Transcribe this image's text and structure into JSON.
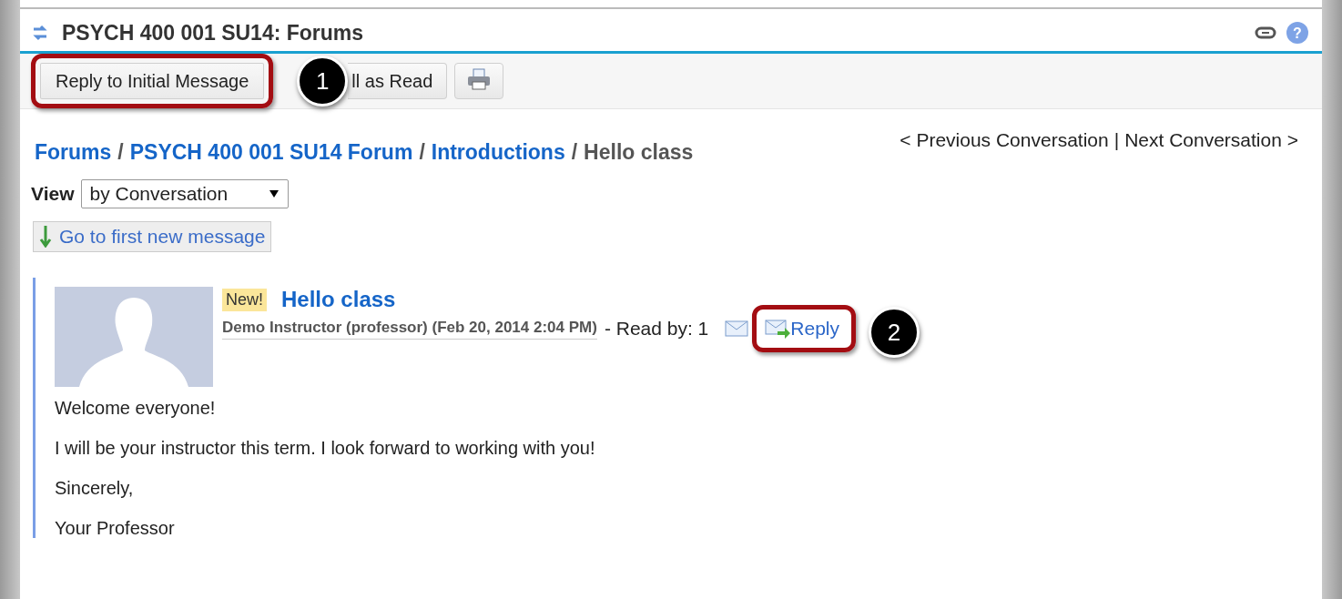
{
  "header": {
    "title": "PSYCH 400 001 SU14: Forums",
    "help": "?"
  },
  "toolbar": {
    "buttons": [
      {
        "label": "Reply to Initial Message",
        "highlighted": true
      },
      {
        "label": "ll as Read",
        "highlighted": false
      }
    ],
    "callout": "1"
  },
  "nav": {
    "previous": "< Previous Conversation",
    "separator": "|",
    "next": "Next Conversation >"
  },
  "breadcrumb": {
    "links": [
      "Forums",
      "PSYCH 400 001 SU14 Forum",
      "Introductions"
    ],
    "separator": "/",
    "current": "Hello class"
  },
  "view": {
    "label": "View",
    "value": "by Conversation"
  },
  "first_new": {
    "label": "Go to first new message"
  },
  "message": {
    "badge": "New!",
    "title": "Hello class",
    "author": "Demo Instructor (professor) (Feb 20, 2014 2:04 PM)",
    "read_by": "- Read by: 1",
    "reply": "Reply",
    "reply_highlighted": true,
    "callout": "2",
    "body": [
      "Welcome everyone!",
      "I will be your instructor this term. I look forward to working with you!",
      "Sincerely,",
      "Your Professor"
    ]
  }
}
